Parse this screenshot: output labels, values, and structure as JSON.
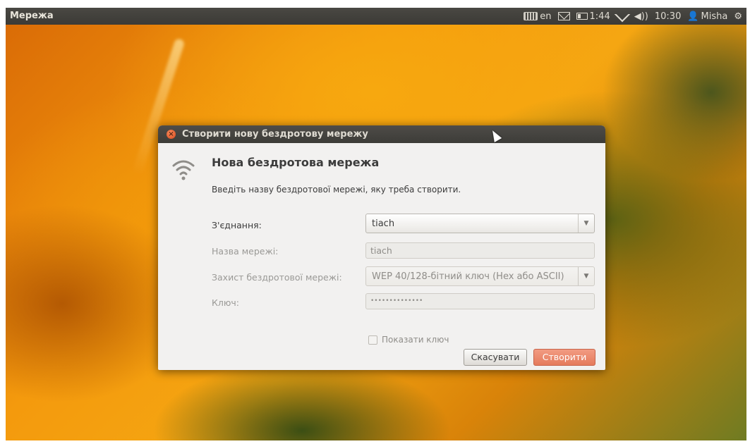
{
  "panel": {
    "app_title": "Мережа",
    "keyboard_layout": "en",
    "battery_time": "1:44",
    "clock": "10:30",
    "user": "Misha",
    "icons": [
      "keyboard-icon",
      "mail-icon",
      "battery-icon",
      "wifi-icon",
      "volume-icon",
      "user-icon",
      "gear-icon"
    ]
  },
  "dialog": {
    "title": "Створити нову бездротову мережу",
    "heading": "Нова бездротова мережа",
    "instruction": "Введіть назву бездротової мережі, яку треба створити.",
    "fields": {
      "connection_label": "З'єднання:",
      "connection_value": "tiach",
      "network_name_label": "Назва мережі:",
      "network_name_value": "tiach",
      "security_label": "Захист бездротової мережі:",
      "security_value": "WEP 40/128-бітний ключ (Hex або ASCII)",
      "key_label": "Ключ:",
      "key_value": "••••••••••••••",
      "show_key_label": "Показати ключ"
    },
    "buttons": {
      "cancel": "Скасувати",
      "create": "Створити"
    }
  },
  "colors": {
    "panel_bg": "#3c3b37",
    "accent_button": "#e57b5c",
    "close_button": "#df4a1e"
  }
}
